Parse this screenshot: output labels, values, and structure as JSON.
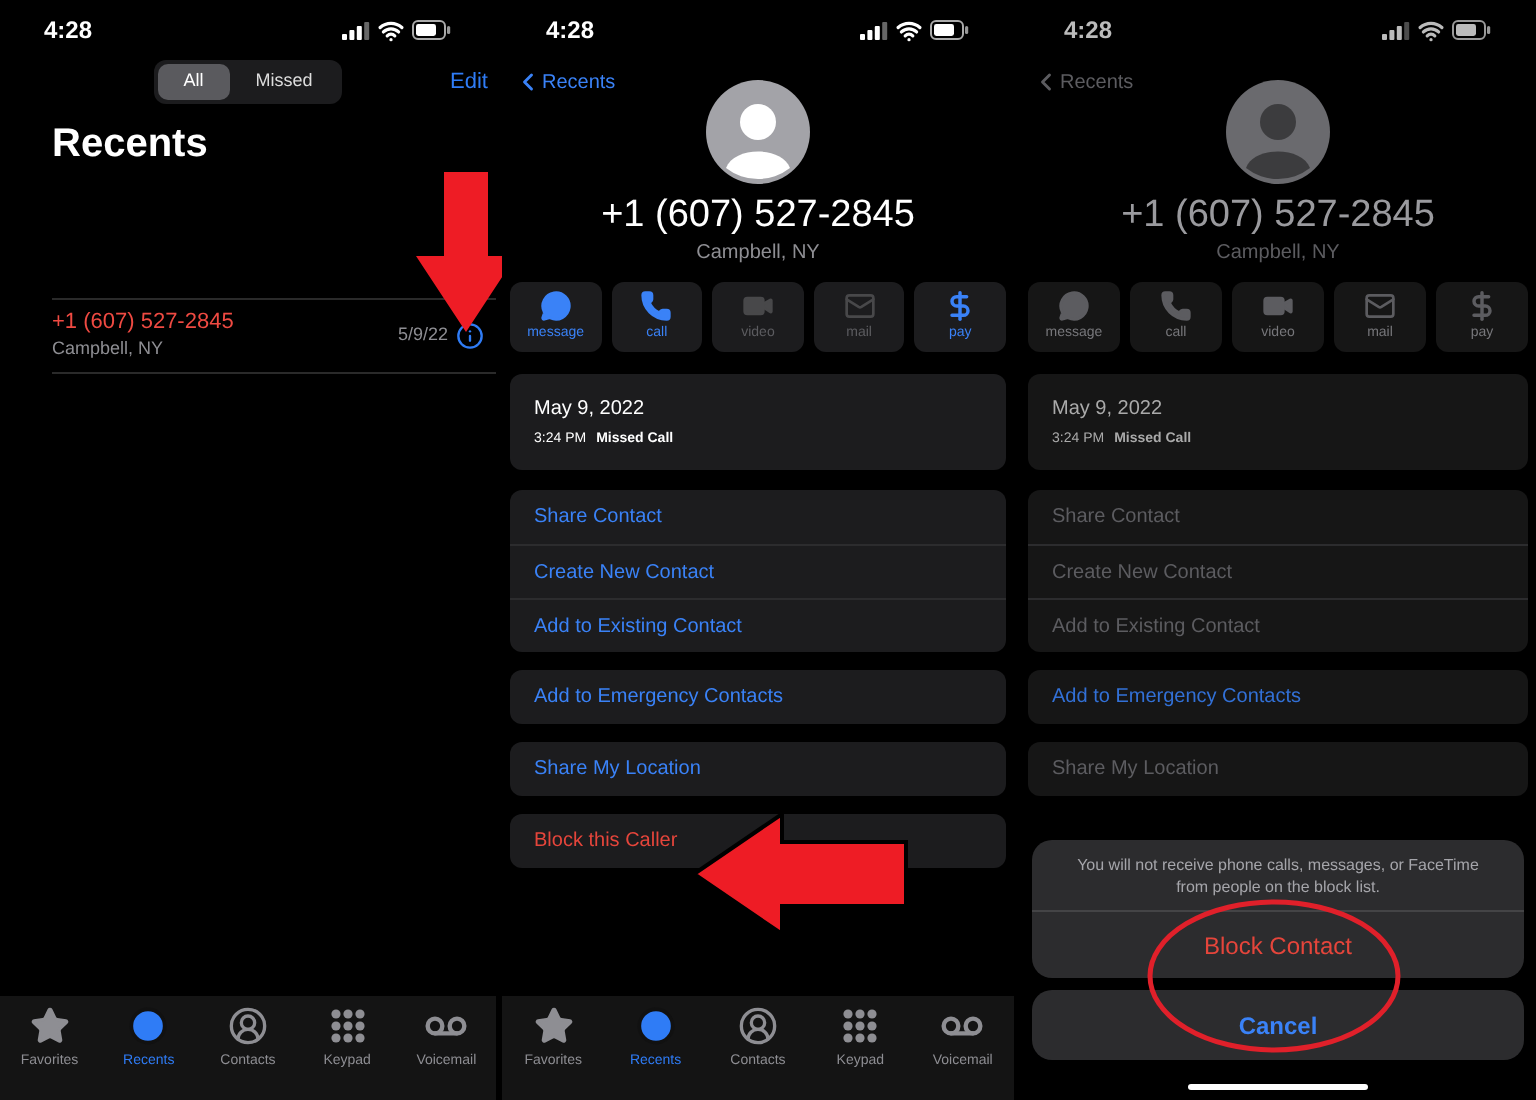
{
  "screens": [
    {
      "kind": "recents",
      "time": "4:28",
      "segments": [
        {
          "label": "All",
          "selected": true
        },
        {
          "label": "Missed",
          "selected": false
        }
      ],
      "edit": "Edit",
      "title": "Recents",
      "calls": [
        {
          "number": "+1 (607) 527-2845",
          "missed": true,
          "location": "Campbell, NY",
          "date": "5/9/22"
        }
      ],
      "tabs": [
        {
          "label": "Favorites",
          "selected": false
        },
        {
          "label": "Recents",
          "selected": true
        },
        {
          "label": "Contacts",
          "selected": false
        },
        {
          "label": "Keypad",
          "selected": false
        },
        {
          "label": "Voicemail",
          "selected": false
        }
      ]
    },
    {
      "kind": "detail",
      "time": "4:28",
      "back": "Recents",
      "number": "+1 (607) 527-2845",
      "location": "Campbell, NY",
      "actions": [
        {
          "label": "message",
          "enabled": true
        },
        {
          "label": "call",
          "enabled": true
        },
        {
          "label": "video",
          "enabled": false
        },
        {
          "label": "mail",
          "enabled": false
        },
        {
          "label": "pay",
          "enabled": true
        }
      ],
      "log": {
        "date": "May 9, 2022",
        "time": "3:24 PM",
        "type": "Missed Call"
      },
      "groups": [
        [
          {
            "label": "Share Contact",
            "kind": "link"
          },
          {
            "label": "Create New Contact",
            "kind": "link"
          },
          {
            "label": "Add to Existing Contact",
            "kind": "link"
          }
        ],
        [
          {
            "label": "Add to Emergency Contacts",
            "kind": "link"
          }
        ],
        [
          {
            "label": "Share My Location",
            "kind": "link"
          }
        ],
        [
          {
            "label": "Block this Caller",
            "kind": "destructive"
          }
        ]
      ],
      "tabs": [
        {
          "label": "Favorites",
          "selected": false
        },
        {
          "label": "Recents",
          "selected": true
        },
        {
          "label": "Contacts",
          "selected": false
        },
        {
          "label": "Keypad",
          "selected": false
        },
        {
          "label": "Voicemail",
          "selected": false
        }
      ]
    },
    {
      "kind": "detail",
      "time": "4:28",
      "back": "Recents",
      "number": "+1 (607) 527-2845",
      "location": "Campbell, NY",
      "actions": [
        {
          "label": "message",
          "enabled": false
        },
        {
          "label": "call",
          "enabled": false
        },
        {
          "label": "video",
          "enabled": false
        },
        {
          "label": "mail",
          "enabled": false
        },
        {
          "label": "pay",
          "enabled": false
        }
      ],
      "log": {
        "date": "May 9, 2022",
        "time": "3:24 PM",
        "type": "Missed Call"
      },
      "groups": [
        [
          {
            "label": "Share Contact",
            "kind": "muted"
          },
          {
            "label": "Create New Contact",
            "kind": "muted"
          },
          {
            "label": "Add to Existing Contact",
            "kind": "muted"
          }
        ],
        [
          {
            "label": "Add to Emergency Contacts",
            "kind": "link"
          }
        ],
        [
          {
            "label": "Share My Location",
            "kind": "muted"
          }
        ]
      ],
      "sheet": {
        "message": "You will not receive phone calls, messages, or FaceTime from people on the block list.",
        "confirm": "Block Contact",
        "cancel": "Cancel"
      }
    }
  ]
}
